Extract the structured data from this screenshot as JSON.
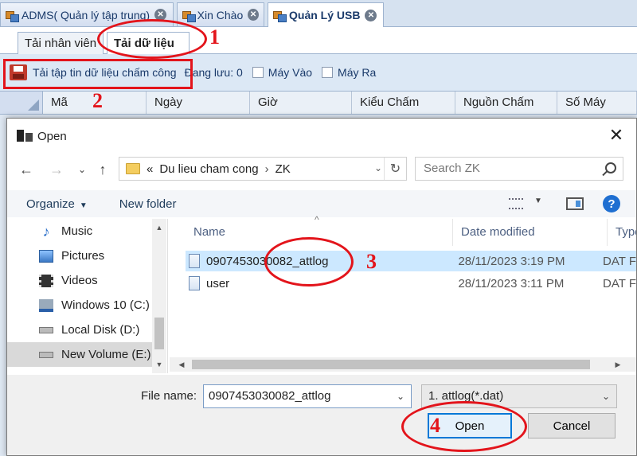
{
  "app_tabs": [
    {
      "label": "ADMS( Quản lý tập trung)",
      "close": "✕"
    },
    {
      "label": "Xin Chào",
      "close": "✕"
    },
    {
      "label": "Quản Lý USB",
      "close": "✕"
    }
  ],
  "sub_tabs": [
    {
      "label": "Tải nhân viên"
    },
    {
      "label": "Tải dữ liệu"
    }
  ],
  "toolbar": {
    "load_button": "Tải tập tin dữ liệu chấm công",
    "saving_status": "Đang lưu: 0",
    "checkbox_in": "Máy Vào",
    "checkbox_out": "Máy Ra"
  },
  "grid_columns": [
    "Mã",
    "Ngày",
    "Giờ",
    "Kiểu Chấm",
    "Nguồn Chấm",
    "Số Máy"
  ],
  "dialog": {
    "title": "Open",
    "close": "✕",
    "nav": {
      "back": "←",
      "forward": "→",
      "dropdown": "⌄",
      "up": "↑",
      "refresh": "↻"
    },
    "address": {
      "chevrons": "«",
      "folder": "Du lieu cham cong",
      "separator": "›",
      "subfolder": "ZK",
      "dropdown": "⌄"
    },
    "search_placeholder": "Search ZK",
    "commands": {
      "organize": "Organize",
      "organize_caret": "▼",
      "new_folder": "New folder",
      "view_caret": "▼",
      "help": "?"
    },
    "nav_pane": {
      "items": [
        "Music",
        "Pictures",
        "Videos",
        "Windows 10 (C:)",
        "Local Disk (D:)",
        "New Volume (E:)"
      ],
      "selected_index": 5,
      "icons": [
        "music-icon",
        "pictures-icon",
        "videos-icon",
        "windows-drive-icon",
        "disk-icon",
        "disk-icon"
      ],
      "scroll_up": "▲",
      "scroll_down": "▼"
    },
    "file_list": {
      "sort_caret": "^",
      "columns": {
        "name": "Name",
        "date_modified": "Date modified",
        "type": "Type"
      },
      "files": [
        {
          "name": "0907453030082_attlog",
          "date": "28/11/2023 3:19 PM",
          "type": "DAT F"
        },
        {
          "name": "user",
          "date": "28/11/2023 3:11 PM",
          "type": "DAT F"
        }
      ],
      "selected_index": 0,
      "scroll_left": "◀",
      "scroll_right": "▶"
    },
    "footer": {
      "file_name_label": "File name:",
      "file_name_value": "0907453030082_attlog",
      "file_name_dropdown": "⌄",
      "file_type_value": "1. attlog(*.dat)",
      "file_type_dropdown": "⌄",
      "open_button": "Open",
      "cancel_button": "Cancel"
    }
  },
  "annotations": {
    "color": "#e3141b",
    "numbers": [
      "1",
      "2",
      "3",
      "4"
    ]
  },
  "colors": {
    "accent": "#0078d7",
    "selection": "#cce8ff",
    "toolbar_bg": "#dce8f5"
  }
}
